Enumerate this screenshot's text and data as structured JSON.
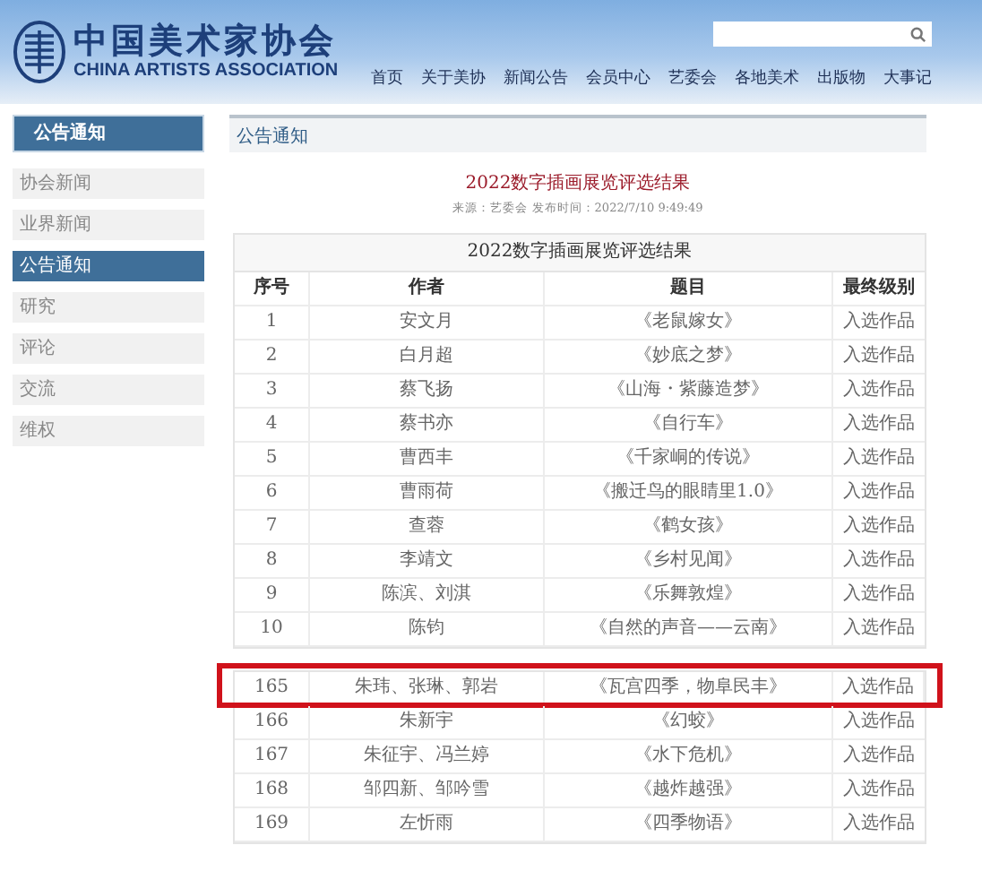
{
  "header": {
    "logo_cn": "中国美术家协会",
    "logo_en": "CHINA ARTISTS ASSOCIATION",
    "nav": [
      {
        "label": "首页"
      },
      {
        "label": "关于美协"
      },
      {
        "label": "新闻公告"
      },
      {
        "label": "会员中心"
      },
      {
        "label": "艺委会"
      },
      {
        "label": "各地美术"
      },
      {
        "label": "出版物"
      },
      {
        "label": "大事记"
      }
    ]
  },
  "sidebar": {
    "title": "公告通知",
    "items": [
      {
        "label": "协会新闻",
        "selected": false
      },
      {
        "label": "业界新闻",
        "selected": false
      },
      {
        "label": "公告通知",
        "selected": true
      },
      {
        "label": "研究",
        "selected": false
      },
      {
        "label": "评论",
        "selected": false
      },
      {
        "label": "交流",
        "selected": false
      },
      {
        "label": "维权",
        "selected": false
      }
    ]
  },
  "panel": {
    "heading": "公告通知",
    "article_title": "2022数字插画展览评选结果",
    "meta": "来源：艺委会 发布时间：2022/7/10 9:49:49"
  },
  "table": {
    "caption": "2022数字插画展览评选结果",
    "columns": [
      "序号",
      "作者",
      "题目",
      "最终级别"
    ],
    "sections": [
      {
        "rows": [
          {
            "cells": [
              "1",
              "安文月",
              "《老鼠嫁女》",
              "入选作品"
            ],
            "highlighted": false
          },
          {
            "cells": [
              "2",
              "白月超",
              "《妙底之梦》",
              "入选作品"
            ],
            "highlighted": false
          },
          {
            "cells": [
              "3",
              "蔡飞扬",
              "《山海・紫藤造梦》",
              "入选作品"
            ],
            "highlighted": false
          },
          {
            "cells": [
              "4",
              "蔡书亦",
              "《自行车》",
              "入选作品"
            ],
            "highlighted": false
          },
          {
            "cells": [
              "5",
              "曹西丰",
              "《千家峒的传说》",
              "入选作品"
            ],
            "highlighted": false
          },
          {
            "cells": [
              "6",
              "曹雨荷",
              "《搬迁鸟的眼睛里1.0》",
              "入选作品"
            ],
            "highlighted": false
          },
          {
            "cells": [
              "7",
              "查蓉",
              "《鹤女孩》",
              "入选作品"
            ],
            "highlighted": false
          },
          {
            "cells": [
              "8",
              "李靖文",
              "《乡村见闻》",
              "入选作品"
            ],
            "highlighted": false
          },
          {
            "cells": [
              "9",
              "陈滨、刘淇",
              "《乐舞敦煌》",
              "入选作品"
            ],
            "highlighted": false
          },
          {
            "cells": [
              "10",
              "陈钧",
              "《自然的声音——云南》",
              "入选作品"
            ],
            "highlighted": false
          }
        ]
      },
      {
        "rows": [
          {
            "cells": [
              "165",
              "朱玮、张琳、郭岩",
              "《瓦宫四季，物阜民丰》",
              "入选作品"
            ],
            "highlighted": true
          },
          {
            "cells": [
              "166",
              "朱新宇",
              "《幻蛟》",
              "入选作品"
            ],
            "highlighted": false
          },
          {
            "cells": [
              "167",
              "朱征宇、冯兰婷",
              "《水下危机》",
              "入选作品"
            ],
            "highlighted": false
          },
          {
            "cells": [
              "168",
              "邹四新、邹吟雪",
              "《越炸越强》",
              "入选作品"
            ],
            "highlighted": false
          },
          {
            "cells": [
              "169",
              "左忻雨",
              "《四季物语》",
              "入选作品"
            ],
            "highlighted": false
          }
        ]
      }
    ]
  }
}
